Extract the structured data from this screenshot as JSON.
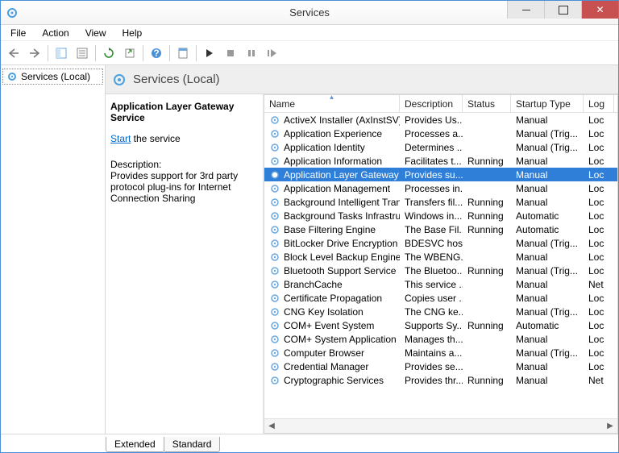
{
  "window": {
    "title": "Services"
  },
  "menu": {
    "file": "File",
    "action": "Action",
    "view": "View",
    "help": "Help"
  },
  "nav": {
    "root": "Services (Local)"
  },
  "content_header": {
    "title": "Services (Local)"
  },
  "detail": {
    "selected_name": "Application Layer Gateway Service",
    "start_link": "Start",
    "start_suffix": " the service",
    "desc_label": "Description:",
    "desc_text": "Provides support for 3rd party protocol plug-ins for Internet Connection Sharing"
  },
  "columns": {
    "name": "Name",
    "description": "Description",
    "status": "Status",
    "startup": "Startup Type",
    "logon": "Log"
  },
  "tabs": {
    "extended": "Extended",
    "standard": "Standard"
  },
  "services": [
    {
      "name": "ActiveX Installer (AxInstSV)",
      "desc": "Provides Us...",
      "status": "",
      "startup": "Manual",
      "logon": "Loc"
    },
    {
      "name": "Application Experience",
      "desc": "Processes a...",
      "status": "",
      "startup": "Manual (Trig...",
      "logon": "Loc"
    },
    {
      "name": "Application Identity",
      "desc": "Determines ...",
      "status": "",
      "startup": "Manual (Trig...",
      "logon": "Loc"
    },
    {
      "name": "Application Information",
      "desc": "Facilitates t...",
      "status": "Running",
      "startup": "Manual",
      "logon": "Loc"
    },
    {
      "name": "Application Layer Gateway ...",
      "desc": "Provides su...",
      "status": "",
      "startup": "Manual",
      "logon": "Loc",
      "selected": true
    },
    {
      "name": "Application Management",
      "desc": "Processes in...",
      "status": "",
      "startup": "Manual",
      "logon": "Loc"
    },
    {
      "name": "Background Intelligent Trans...",
      "desc": "Transfers fil...",
      "status": "Running",
      "startup": "Manual",
      "logon": "Loc"
    },
    {
      "name": "Background Tasks Infrastru...",
      "desc": "Windows in...",
      "status": "Running",
      "startup": "Automatic",
      "logon": "Loc"
    },
    {
      "name": "Base Filtering Engine",
      "desc": "The Base Fil...",
      "status": "Running",
      "startup": "Automatic",
      "logon": "Loc"
    },
    {
      "name": "BitLocker Drive Encryption ...",
      "desc": "BDESVC hos...",
      "status": "",
      "startup": "Manual (Trig...",
      "logon": "Loc"
    },
    {
      "name": "Block Level Backup Engine ...",
      "desc": "The WBENG...",
      "status": "",
      "startup": "Manual",
      "logon": "Loc"
    },
    {
      "name": "Bluetooth Support Service",
      "desc": "The Bluetoo...",
      "status": "Running",
      "startup": "Manual (Trig...",
      "logon": "Loc"
    },
    {
      "name": "BranchCache",
      "desc": "This service ...",
      "status": "",
      "startup": "Manual",
      "logon": "Net"
    },
    {
      "name": "Certificate Propagation",
      "desc": "Copies user ...",
      "status": "",
      "startup": "Manual",
      "logon": "Loc"
    },
    {
      "name": "CNG Key Isolation",
      "desc": "The CNG ke...",
      "status": "",
      "startup": "Manual (Trig...",
      "logon": "Loc"
    },
    {
      "name": "COM+ Event System",
      "desc": "Supports Sy...",
      "status": "Running",
      "startup": "Automatic",
      "logon": "Loc"
    },
    {
      "name": "COM+ System Application",
      "desc": "Manages th...",
      "status": "",
      "startup": "Manual",
      "logon": "Loc"
    },
    {
      "name": "Computer Browser",
      "desc": "Maintains a...",
      "status": "",
      "startup": "Manual (Trig...",
      "logon": "Loc"
    },
    {
      "name": "Credential Manager",
      "desc": "Provides se...",
      "status": "",
      "startup": "Manual",
      "logon": "Loc"
    },
    {
      "name": "Cryptographic Services",
      "desc": "Provides thr...",
      "status": "Running",
      "startup": "Manual",
      "logon": "Net"
    }
  ]
}
